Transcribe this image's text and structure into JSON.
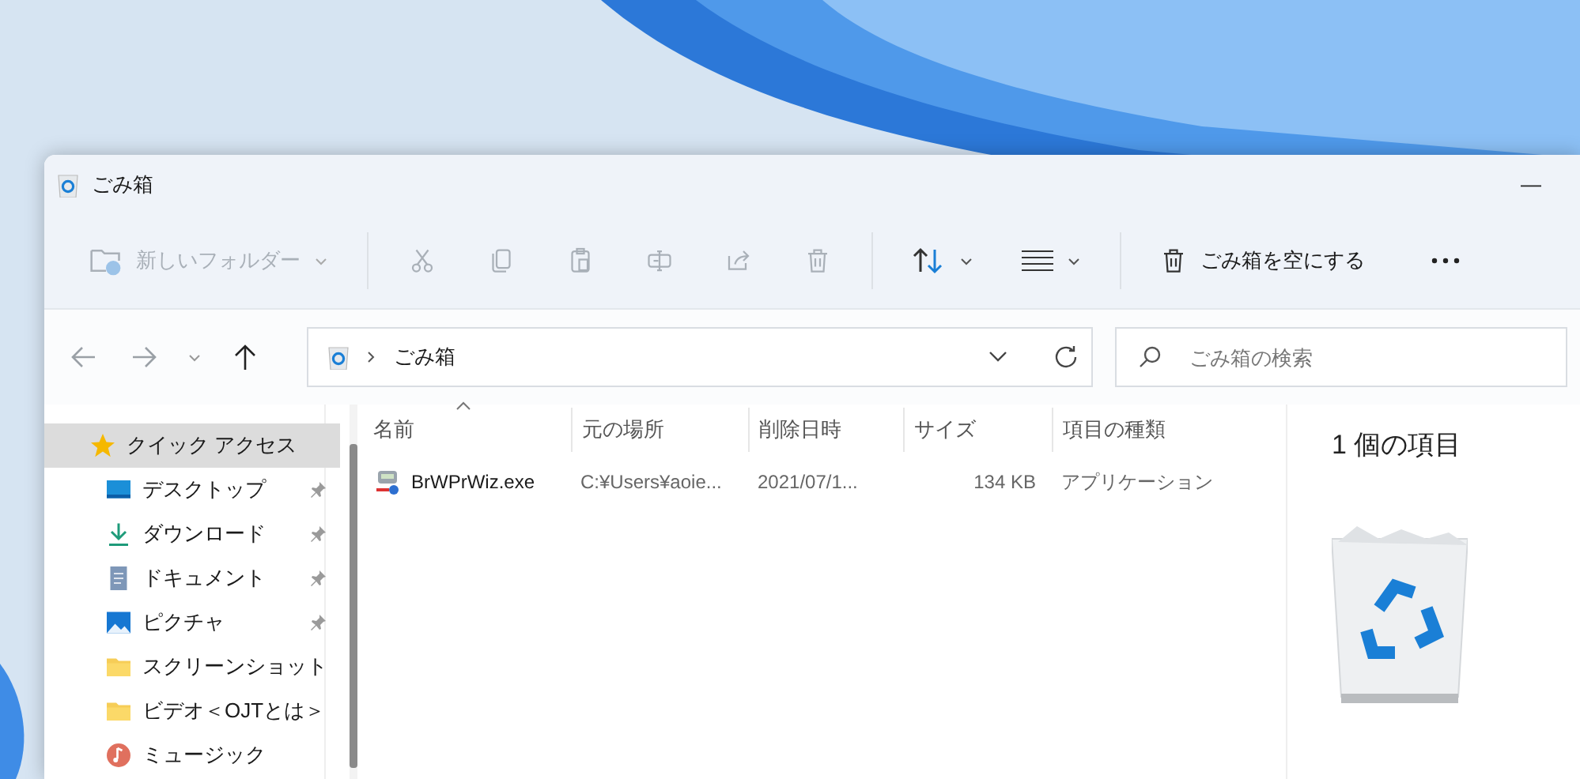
{
  "window": {
    "title": "ごみ箱",
    "minimize": "—"
  },
  "toolbar": {
    "new_folder": {
      "label": "新しいフォルダー",
      "disabled": true
    },
    "actions": [
      {
        "kind": "cut",
        "disabled": true
      },
      {
        "kind": "copy",
        "disabled": true
      },
      {
        "kind": "paste",
        "disabled": true
      },
      {
        "kind": "rename",
        "disabled": true
      },
      {
        "kind": "share",
        "disabled": true
      },
      {
        "kind": "delete",
        "disabled": true
      }
    ],
    "sort": {
      "disabled": false
    },
    "view": {
      "disabled": false
    },
    "empty_bin": {
      "label": "ごみ箱を空にする",
      "disabled": false
    }
  },
  "nav": {
    "back": {
      "disabled": true
    },
    "forward": {
      "disabled": true
    },
    "up": {
      "disabled": false
    }
  },
  "address": {
    "path": [
      "ごみ箱"
    ]
  },
  "search": {
    "placeholder": "ごみ箱の検索"
  },
  "sidebar": {
    "items": [
      {
        "label": "クイック アクセス",
        "kind": "star",
        "selected": true,
        "pinned": false,
        "children": [
          {
            "label": "デスクトップ",
            "kind": "desktop",
            "selected": false,
            "pinned": true
          },
          {
            "label": "ダウンロード",
            "kind": "download",
            "selected": false,
            "pinned": true
          },
          {
            "label": "ドキュメント",
            "kind": "document",
            "selected": false,
            "pinned": true
          },
          {
            "label": "ピクチャ",
            "kind": "picture",
            "selected": false,
            "pinned": true
          },
          {
            "label": "スクリーンショット",
            "kind": "folder",
            "selected": false,
            "pinned": false
          },
          {
            "label": "ビデオ＜OJTとは＞",
            "kind": "folder",
            "selected": false,
            "pinned": false
          },
          {
            "label": "ミュージック",
            "kind": "music",
            "selected": false,
            "pinned": false
          }
        ]
      }
    ]
  },
  "table": {
    "columns": [
      {
        "label": "名前",
        "sorted": true
      },
      {
        "label": "元の場所",
        "sorted": false
      },
      {
        "label": "削除日時",
        "sorted": false
      },
      {
        "label": "サイズ",
        "sorted": false
      },
      {
        "label": "項目の種類",
        "sorted": false
      }
    ],
    "rows": [
      {
        "cells": [
          "BrWPrWiz.exe",
          "C:¥Users¥aoie...",
          "2021/07/1...",
          "134 KB",
          "アプリケーション"
        ],
        "selected": false
      }
    ]
  },
  "details": {
    "title": "1 個の項目"
  }
}
